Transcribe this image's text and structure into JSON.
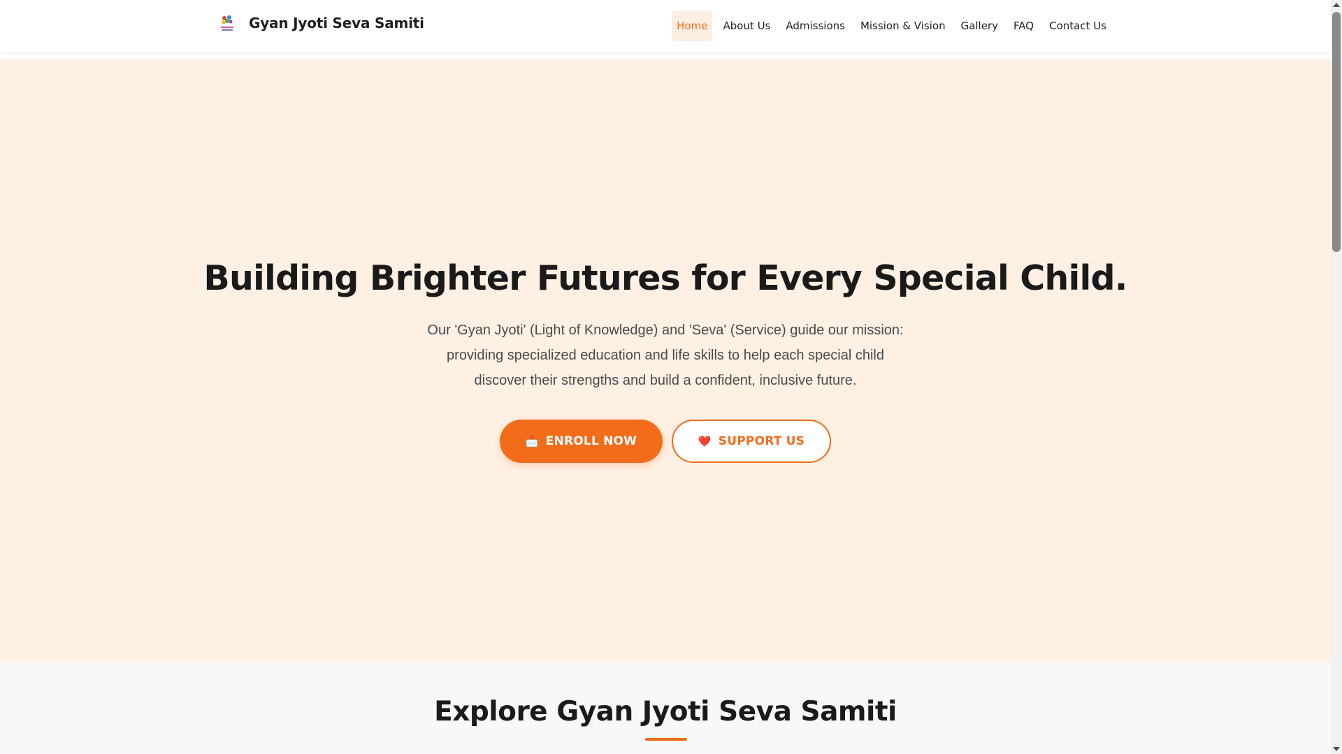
{
  "header": {
    "brand_name": "Gyan Jyoti Seva Samiti",
    "nav": [
      {
        "label": "Home",
        "active": true
      },
      {
        "label": "About Us"
      },
      {
        "label": "Admissions"
      },
      {
        "label": "Mission & Vision"
      },
      {
        "label": "Gallery"
      },
      {
        "label": "FAQ"
      },
      {
        "label": "Contact Us"
      }
    ]
  },
  "hero": {
    "title": "Building Brighter Futures for Every Special Child.",
    "description": "Our 'Gyan Jyoti' (Light of Knowledge) and 'Seva' (Service) guide our mission: providing specialized education and life skills to help each special child discover their strengths and build a confident, inclusive future.",
    "enroll_icon": "📩",
    "enroll_label": "ENROLL NOW",
    "support_icon": "❤️",
    "support_label": "SUPPORT US"
  },
  "explore": {
    "title": "Explore Gyan Jyoti Seva Samiti"
  },
  "colors": {
    "accent": "#f26c1a",
    "hero_bg": "#fff0e4",
    "active_nav_bg": "#fdeee2",
    "section_bg": "#f7f8fa"
  }
}
